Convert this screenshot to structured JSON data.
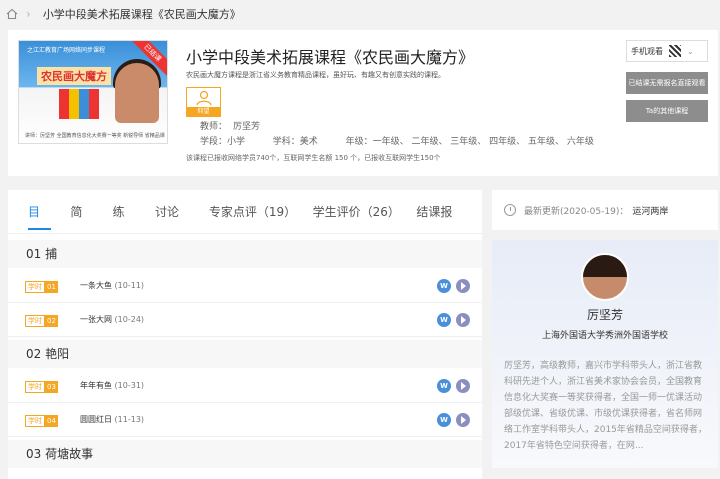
{
  "breadcrumb": {
    "current": "小学中段美术拓展课程《农民画大魔方》"
  },
  "course": {
    "title": "小学中段美术拓展课程《农民画大魔方》",
    "description": "农民画大魔方课程是浙江省义务教育精品课程，虽好玩、有趣又有创意实践的课程。",
    "tag_label": "仰望",
    "teacher_label": "教师：",
    "teacher_name": "厉坚芳",
    "stage_label": "学段：",
    "stage_value": "小学",
    "subject_label": "学科：",
    "subject_value": "美术",
    "grade_label": "年级：",
    "grade_value": "一年级、 二年级、 三年级、 四年级、 五年级、 六年级",
    "stats": "该课程已报收网络学员740个，互联网学生名额 150 个，已报收互联网学生150个",
    "cover": {
      "top_text": "之江汇教育广场网络同步课程",
      "title_text": "农民画大魔方",
      "badge": "已结课",
      "footer_text": "讲师：厉坚芳  全国教育信息化大奖赛一等奖  新锐导师  省精品课"
    }
  },
  "actions": {
    "mobile_watch": "手机观看",
    "btn_direct_watch": "已结课无需报名直接观看",
    "btn_other_courses": "Ta的其他课程"
  },
  "tabs": [
    {
      "label": "目录"
    },
    {
      "label": "简介"
    },
    {
      "label": "练习"
    },
    {
      "label": "讨论区"
    },
    {
      "label": "专家点评（19）"
    },
    {
      "label": "学生评价（26）"
    },
    {
      "label": "结课报告"
    }
  ],
  "catalog": {
    "sections": [
      {
        "title": "01  捕"
      },
      {
        "title": "02  艳阳"
      },
      {
        "title": "03  荷塘故事"
      }
    ],
    "lessons": [
      {
        "badge_a": "学时",
        "badge_b": "01",
        "name": "一条大鱼",
        "date": " (10-11)",
        "w": "W"
      },
      {
        "badge_a": "学时",
        "badge_b": "02",
        "name": "一张大网",
        "date": " (10-24)",
        "w": "W"
      },
      {
        "badge_a": "学时",
        "badge_b": "03",
        "name": "年年有鱼",
        "date": " (10-31)",
        "w": "W"
      },
      {
        "badge_a": "学时",
        "badge_b": "04",
        "name": "圆圆红日",
        "date": " (11-13)",
        "w": "W"
      }
    ]
  },
  "update": {
    "label": "最新更新(2020-05-19)：",
    "link": "运河两岸"
  },
  "teacher_card": {
    "name": "厉坚芳",
    "school": "上海外国语大学秀洲外国语学校",
    "bio": "厉坚芳，高级教师，嘉兴市学科带头人，浙江省教科研先进个人，浙江省美术家协会会员，全国教育信息化大奖赛一等奖获得者，全国一师一优课活动部级优课、省级优课、市级优课获得者，省名师网络工作室学科带头人，2015年省精品空间获得者，2017年省特色空间获得者，在网..."
  }
}
